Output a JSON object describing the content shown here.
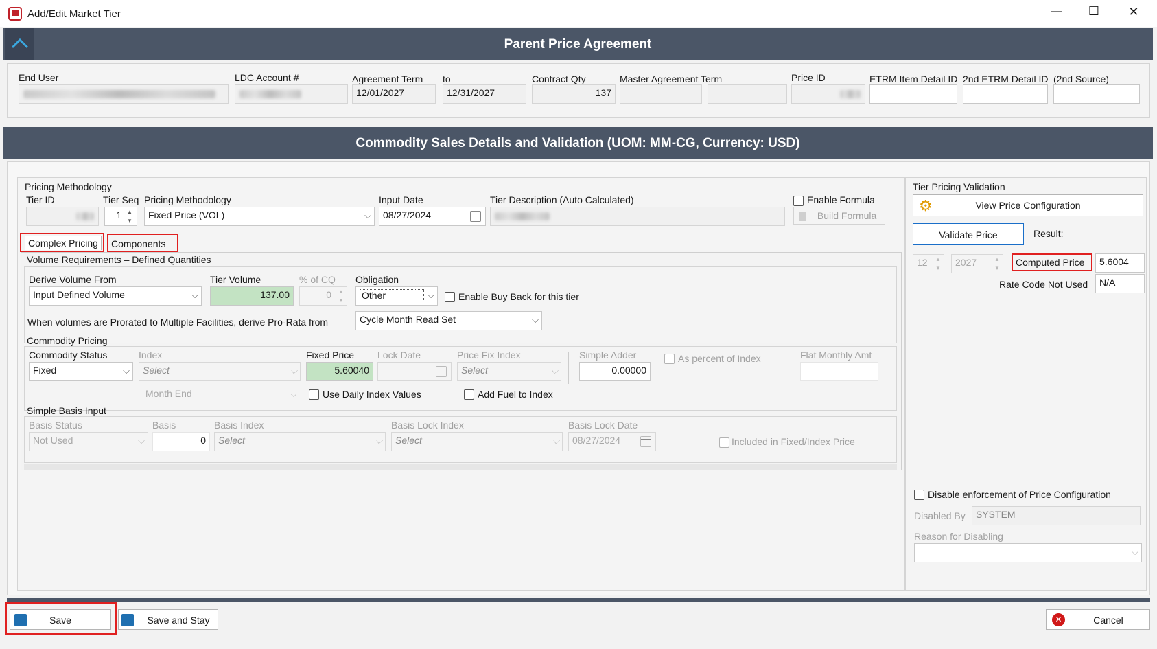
{
  "window": {
    "title": "Add/Edit Market Tier",
    "minimize": "—",
    "maximize": "☐",
    "close": "✕"
  },
  "parent": {
    "header": "Parent Price Agreement",
    "end_user_label": "End User",
    "ldc_label": "LDC Account #",
    "agreement_term_label": "Agreement Term",
    "to_label": "to",
    "contract_qty_label": "Contract Qty",
    "master_term_label": "Master Agreement Term",
    "price_id_label": "Price ID",
    "etrm_label": "ETRM Item Detail ID",
    "etrm2_label": "2nd ETRM Detail ID",
    "second_source_label": "(2nd Source)",
    "term_start": "12/01/2027",
    "term_end": "12/31/2027",
    "contract_qty": "137"
  },
  "commodity": {
    "header": "Commodity Sales Details and Validation (UOM: MM-CG, Currency: USD)"
  },
  "methodology": {
    "group_label": "Pricing Methodology",
    "tier_id_label": "Tier ID",
    "tier_seq_label": "Tier Seq",
    "tier_seq_value": "1",
    "pricing_methodology_label": "Pricing Methodology",
    "pricing_methodology_value": "Fixed Price (VOL)",
    "input_date_label": "Input Date",
    "input_date_value": "08/27/2024",
    "tier_desc_label": "Tier Description (Auto Calculated)",
    "enable_formula_label": "Enable Formula",
    "build_formula_label": "Build Formula"
  },
  "tabs": {
    "complex": "Complex Pricing",
    "components": "Components"
  },
  "volume": {
    "group_label": "Volume Requirements – Defined Quantities",
    "derive_label": "Derive Volume From",
    "derive_value": "Input Defined Volume",
    "tier_volume_label": "Tier Volume",
    "tier_volume_value": "137.00",
    "pct_cq_label": "% of CQ",
    "pct_cq_value": "0",
    "obligation_label": "Obligation",
    "obligation_value": "Other",
    "buy_back_label": "Enable Buy Back for this tier",
    "prorata_label": "When volumes are Prorated to Multiple Facilities, derive Pro-Rata from",
    "prorata_value": "Cycle Month Read Set"
  },
  "commodity_pricing": {
    "group_label": "Commodity Pricing",
    "status_label": "Commodity Status",
    "status_value": "Fixed",
    "index_label": "Index",
    "index_value": "Select",
    "fixed_price_label": "Fixed Price",
    "fixed_price_value": "5.60040",
    "lock_date_label": "Lock Date",
    "price_fix_index_label": "Price Fix Index",
    "price_fix_index_value": "Select",
    "simple_adder_label": "Simple Adder",
    "simple_adder_value": "0.00000",
    "as_percent_label": "As percent of Index",
    "flat_monthly_label": "Flat Monthly Amt",
    "month_end_value": "Month End",
    "daily_index_label": "Use Daily Index Values",
    "add_fuel_label": "Add Fuel to Index"
  },
  "basis": {
    "group_label": "Simple Basis Input",
    "status_label": "Basis Status",
    "status_value": "Not Used",
    "basis_label": "Basis",
    "basis_value": "0",
    "basis_index_label": "Basis Index",
    "basis_index_value": "Select",
    "lock_index_label": "Basis Lock Index",
    "lock_index_value": "Select",
    "lock_date_label": "Basis Lock Date",
    "lock_date_value": "08/27/2024",
    "included_label": "Included in Fixed/Index Price"
  },
  "validation": {
    "group_label": "Tier Pricing Validation",
    "view_config_label": "View Price Configuration",
    "validate_label": "Validate Price",
    "result_label": "Result:",
    "month_value": "12",
    "year_value": "2027",
    "computed_label": "Computed Price",
    "computed_value": "5.6004",
    "rate_code_label": "Rate Code Not Used",
    "rate_code_value": "N/A",
    "disable_label": "Disable enforcement of Price Configuration",
    "disabled_by_label": "Disabled By",
    "disabled_by_value": "SYSTEM",
    "reason_label": "Reason for Disabling"
  },
  "footer": {
    "save": "Save",
    "save_stay": "Save and Stay",
    "cancel": "Cancel"
  },
  "colors": {
    "header_bg": "#4b5667",
    "accent": "#1a6fc9",
    "highlight": "#e02020",
    "green_field": "#c3e3c3"
  }
}
